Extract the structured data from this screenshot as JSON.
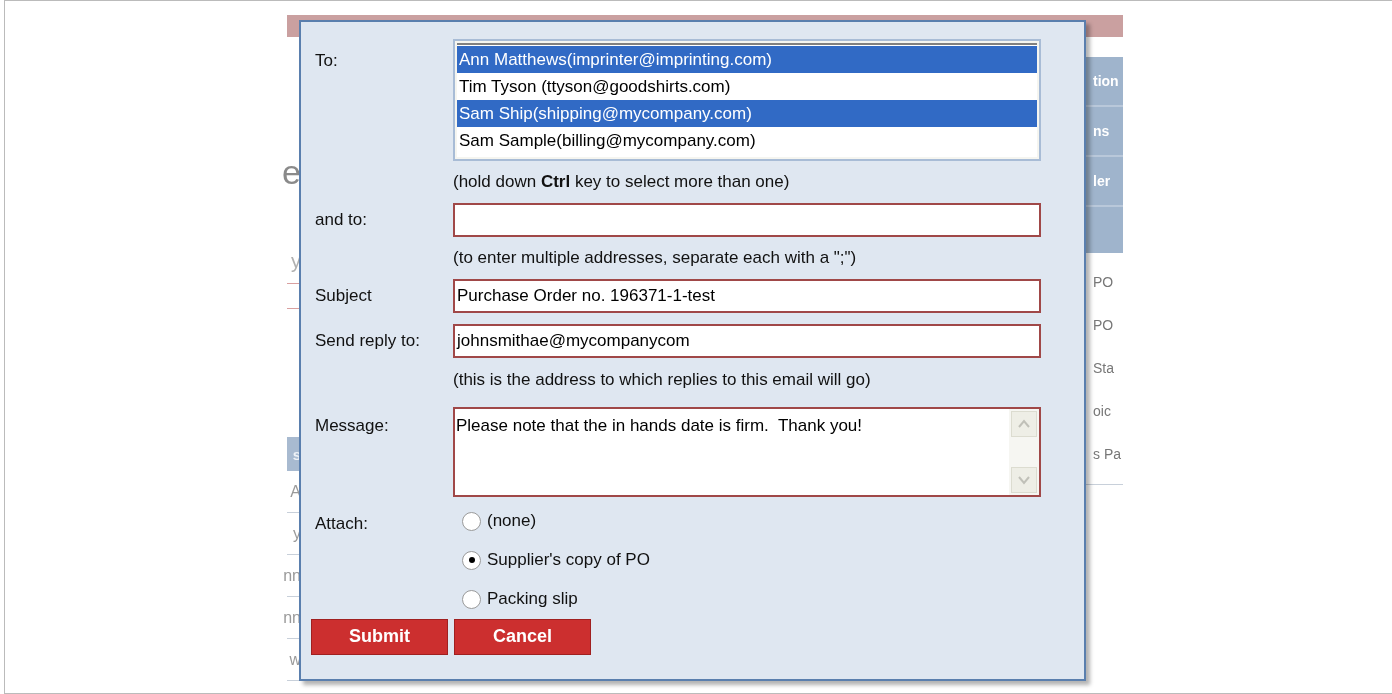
{
  "background": {
    "left_fragments": [
      {
        "kind": "heading",
        "text": "e"
      },
      {
        "kind": "subheading",
        "text": "y"
      },
      {
        "kind": "header",
        "text": "s"
      },
      {
        "kind": "row",
        "text": "A"
      },
      {
        "kind": "row",
        "text": "y"
      },
      {
        "kind": "row",
        "text": "nn"
      },
      {
        "kind": "row",
        "text": "nn"
      },
      {
        "kind": "row",
        "text": "w"
      }
    ],
    "right_nav": [
      "tion",
      "ns",
      "ler"
    ],
    "right_items": [
      "PO",
      "PO",
      "Sta",
      "oic",
      "s Pa"
    ]
  },
  "dialog": {
    "to": {
      "label": "To:",
      "recipients": [
        {
          "text": "Ann Matthews(imprinter@imprinting.com)",
          "selected": true
        },
        {
          "text": "Tim Tyson (ttyson@goodshirts.com)",
          "selected": false
        },
        {
          "text": "Sam Ship(shipping@mycompany.com)",
          "selected": true
        },
        {
          "text": "Sam Sample(billing@mycompany.com)",
          "selected": false
        }
      ],
      "hint": "(hold down **Ctrl** key to select more than one)"
    },
    "and_to": {
      "label": "and to:",
      "hint": "(to enter multiple addresses, separate each with a \";\")"
    },
    "subject": {
      "label": "Subject",
      "value": "Purchase Order no. 196371-1-test"
    },
    "reply_to": {
      "label": "Send reply to:",
      "value": "johnsmithae@mycompanycom",
      "hint": "(this is the address to which replies to this email will go)"
    },
    "message": {
      "label": "Message:",
      "value": "Please note that the in hands date is firm.  Thank you!"
    },
    "attach": {
      "label": "Attach:",
      "options": [
        {
          "label": "(none)",
          "selected": false
        },
        {
          "label": "Supplier's copy of PO",
          "selected": true
        },
        {
          "label": "Packing slip",
          "selected": false
        }
      ]
    },
    "buttons": [
      "Submit",
      "Cancel"
    ]
  }
}
